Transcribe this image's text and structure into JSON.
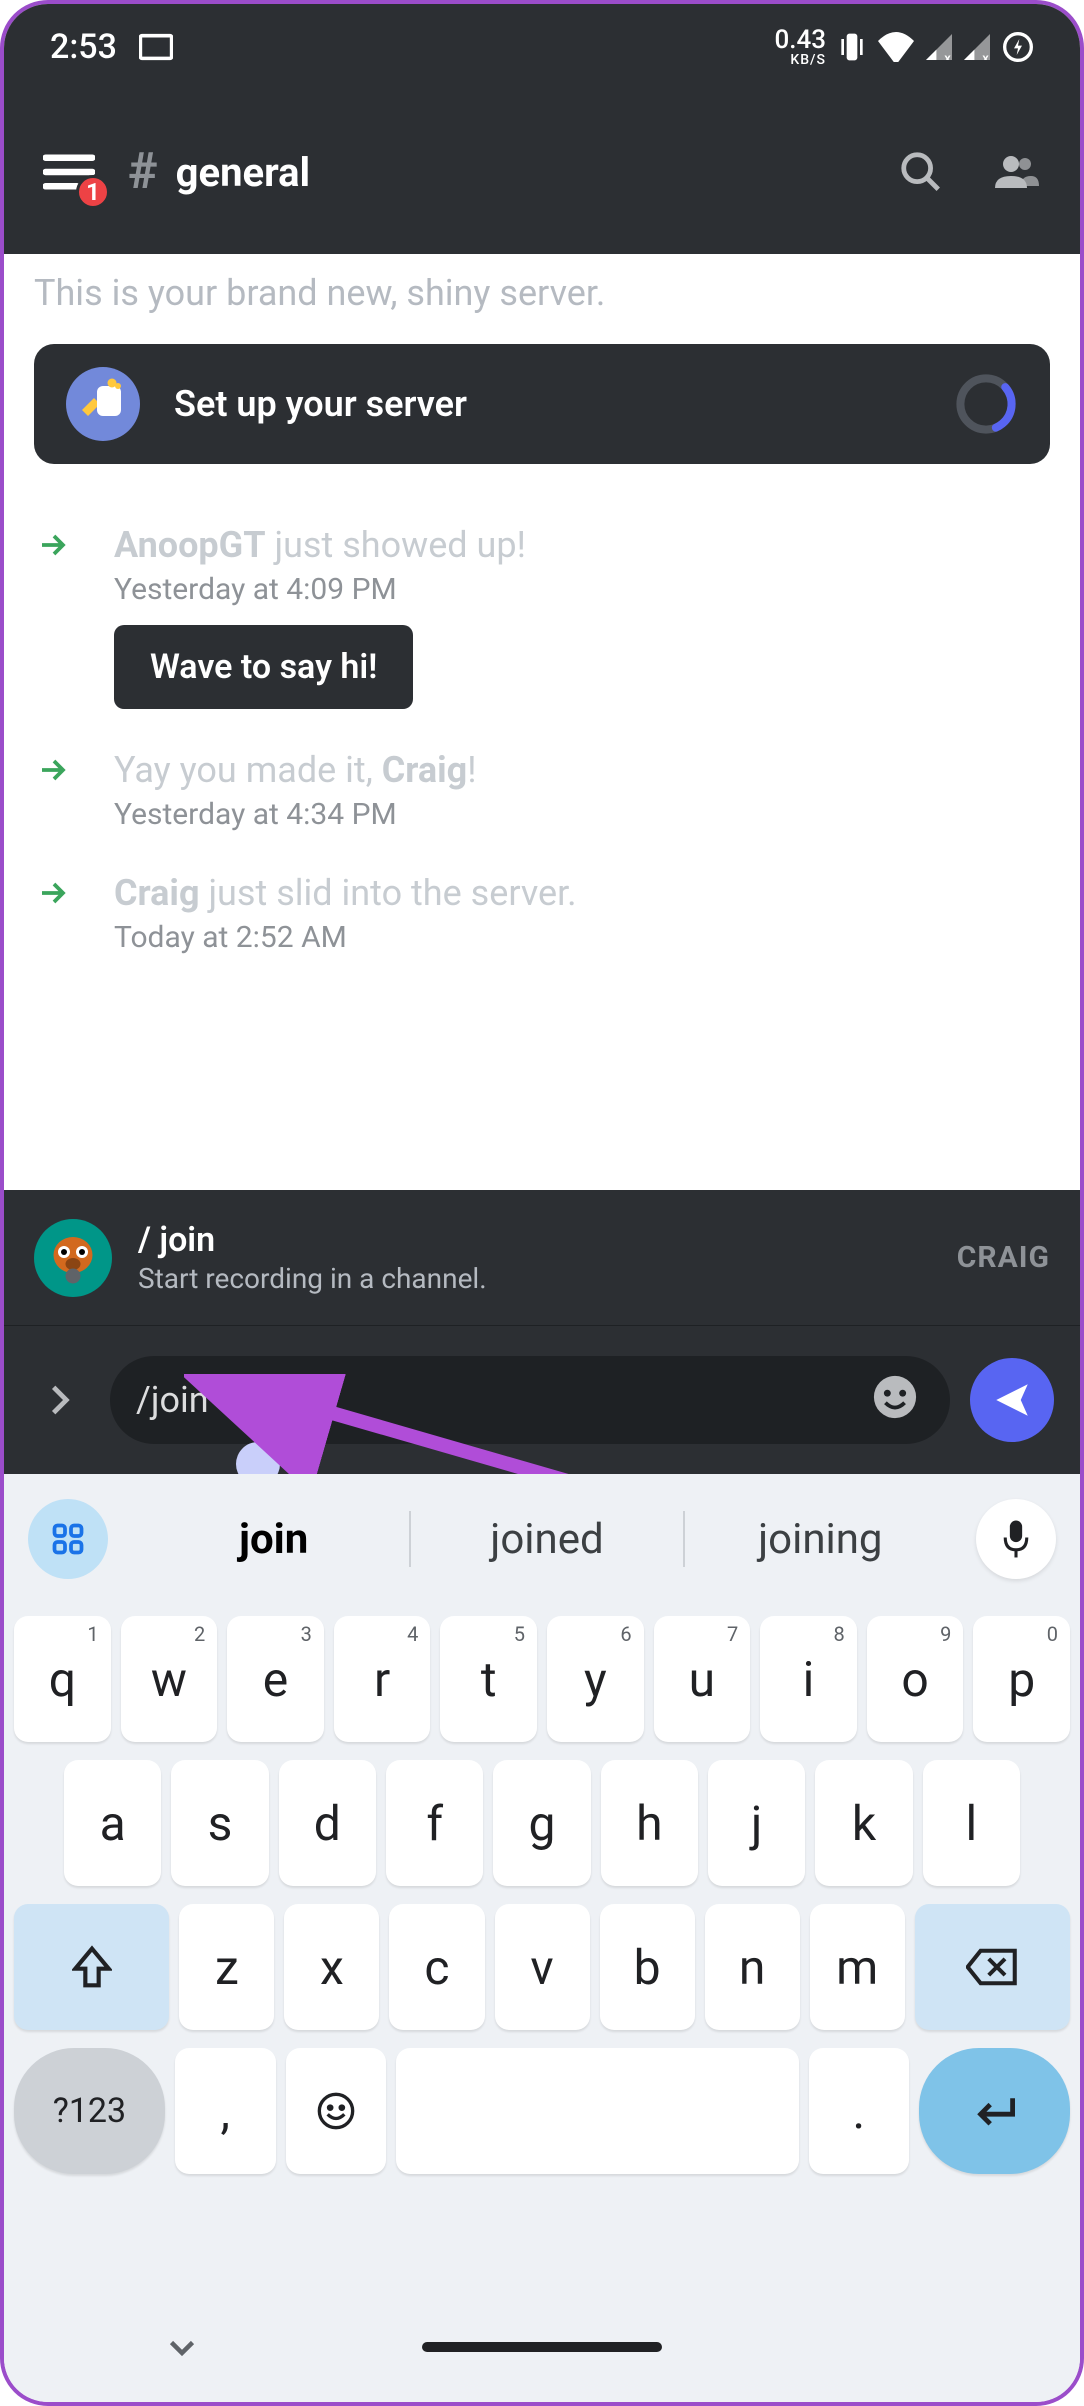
{
  "status": {
    "time": "2:53",
    "data_rate": "0.43",
    "data_unit": "KB/S"
  },
  "app_bar": {
    "badge_count": "1",
    "channel_name": "general"
  },
  "welcome": {
    "text": "This is your brand new, shiny server."
  },
  "setup_card": {
    "label": "Set up your server"
  },
  "messages": [
    {
      "username": "AnoopGT",
      "action_text": " just showed up!",
      "timestamp": "Yesterday at 4:09 PM",
      "button_label": "Wave to say hi!"
    },
    {
      "prefix": "Yay you made it, ",
      "username": "Craig",
      "suffix": "!",
      "timestamp": "Yesterday at 4:34 PM"
    },
    {
      "username": "Craig",
      "action_text": " just slid into the server.",
      "timestamp": "Today at 2:52 AM"
    }
  ],
  "command_suggestion": {
    "name": "/ join",
    "description": "Start recording in a channel.",
    "bot_name": "CRAIG"
  },
  "input": {
    "text": "/join"
  },
  "keyboard": {
    "suggestions": [
      "join",
      "joined",
      "joining"
    ],
    "row1": [
      {
        "k": "q",
        "s": "1"
      },
      {
        "k": "w",
        "s": "2"
      },
      {
        "k": "e",
        "s": "3"
      },
      {
        "k": "r",
        "s": "4"
      },
      {
        "k": "t",
        "s": "5"
      },
      {
        "k": "y",
        "s": "6"
      },
      {
        "k": "u",
        "s": "7"
      },
      {
        "k": "i",
        "s": "8"
      },
      {
        "k": "o",
        "s": "9"
      },
      {
        "k": "p",
        "s": "0"
      }
    ],
    "row2": [
      "a",
      "s",
      "d",
      "f",
      "g",
      "h",
      "j",
      "k",
      "l"
    ],
    "row3": [
      "z",
      "x",
      "c",
      "v",
      "b",
      "n",
      "m"
    ],
    "sym_label": "?123",
    "comma": ",",
    "period": "."
  }
}
